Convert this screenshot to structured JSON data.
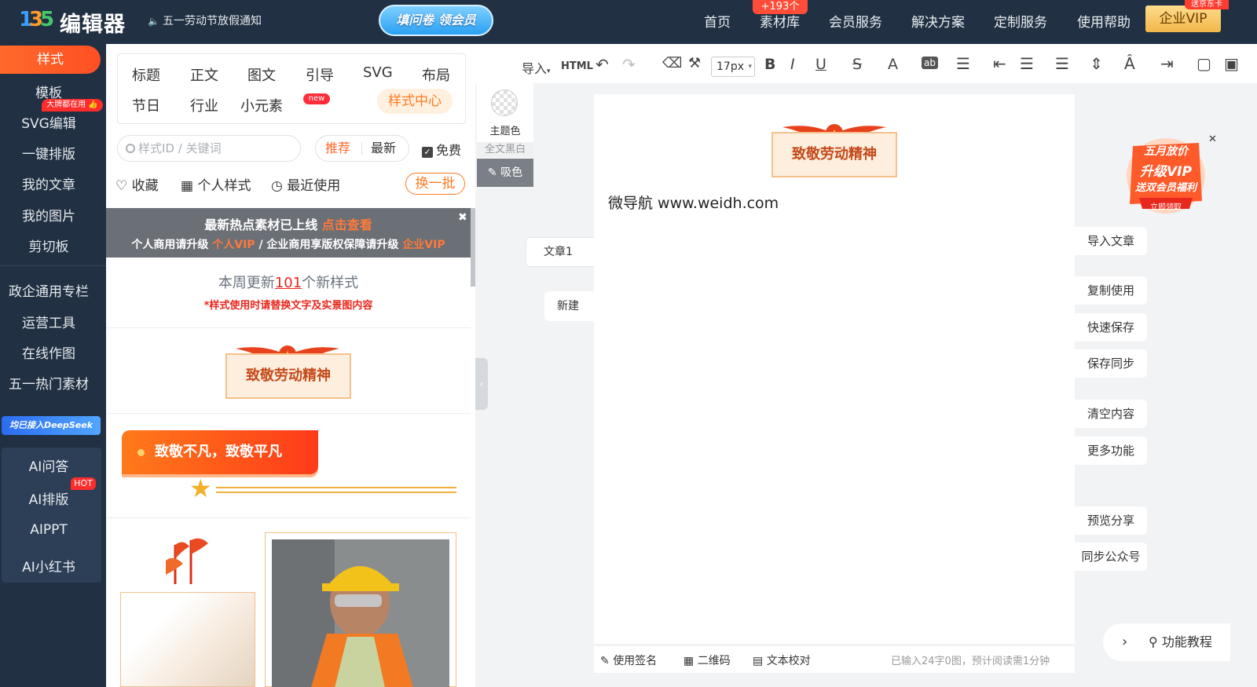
{
  "app": {
    "logo_text": "编辑器",
    "notice": "五一劳动节放假通知",
    "survey_button": "填问卷 领会员"
  },
  "nav": {
    "items": [
      "首页",
      "素材库",
      "会员服务",
      "解决方案",
      "定制服务",
      "使用帮助"
    ],
    "badge": "+193个",
    "vip_button": "企业VIP",
    "vip_tag": "送京东卡"
  },
  "sidebar": {
    "active": "样式",
    "items": [
      "模板",
      "SVG编辑",
      "一键排版",
      "我的文章",
      "我的图片",
      "剪切板"
    ],
    "hot_tag": "大牌都在用",
    "items2": [
      "政企通用专栏",
      "运营工具",
      "在线作图",
      "五一热门素材"
    ],
    "deepseek": "均已接入DeepSeek",
    "ai_items": [
      "AI问答",
      "AI排版",
      "AIPPT",
      "AI小红书"
    ],
    "ai_hot": "HOT"
  },
  "panel": {
    "categories_row1": [
      "标题",
      "正文",
      "图文",
      "引导",
      "SVG",
      "布局"
    ],
    "categories_row2": [
      "节日",
      "行业",
      "小元素"
    ],
    "new_tag": "new",
    "active_category": "样式中心",
    "search_placeholder": "样式ID / 关键词",
    "seg_recommend": "推荐",
    "seg_latest": "最新",
    "free_label": "免费",
    "tools": [
      "收藏",
      "个人样式",
      "最近使用"
    ],
    "refresh": "换一批",
    "promo_line1_a": "最新热点素材已上线",
    "promo_line1_b": "点击查看",
    "promo_line2_a": "个人商用请升级",
    "promo_line2_b": "个人VIP",
    "promo_line2_c": "/ 企业商用享版权保障请升级",
    "promo_line2_d": "企业VIP",
    "update_a": "本周更新",
    "update_num": "101",
    "update_b": "个新样式",
    "update_note": "*样式使用时请替换文字及实景图内容",
    "card_title": "致敬劳动精神",
    "banner_text": "致敬不凡，致敬平凡"
  },
  "toolbar": {
    "import": "导入",
    "html": "HTML",
    "font_size": "17px",
    "icons": [
      "undo-icon",
      "redo-icon",
      "eraser-icon",
      "format-painter-icon",
      "bold-icon",
      "italic-icon",
      "underline-icon",
      "strikethrough-icon",
      "font-color-icon",
      "highlight-icon",
      "align-icon",
      "indent-icon",
      "paragraph-spacing-icon",
      "line-spacing-icon",
      "letter-spacing-icon",
      "clear-format-icon"
    ]
  },
  "theme": {
    "label": "主题色",
    "bw": "全文黑白",
    "picker": "吸色"
  },
  "editor": {
    "doc_tab": "文章1",
    "new_tab": "新建",
    "card_title": "致敬劳动精神",
    "body_text": "微导航 www.weidh.com",
    "status_sign": "使用签名",
    "status_qr": "二维码",
    "status_check": "文本校对",
    "status_count": "已输入24字0图，预计阅读需1分钟"
  },
  "right_tools": [
    "导入文章",
    "复制使用",
    "快速保存",
    "保存同步",
    "清空内容",
    "更多功能",
    "预览分享",
    "同步公众号"
  ],
  "ad": {
    "line1": "五月放价",
    "line2": "升级VIP",
    "line3": "送双会员福利",
    "line4": "立即领取"
  },
  "help": "功能教程"
}
